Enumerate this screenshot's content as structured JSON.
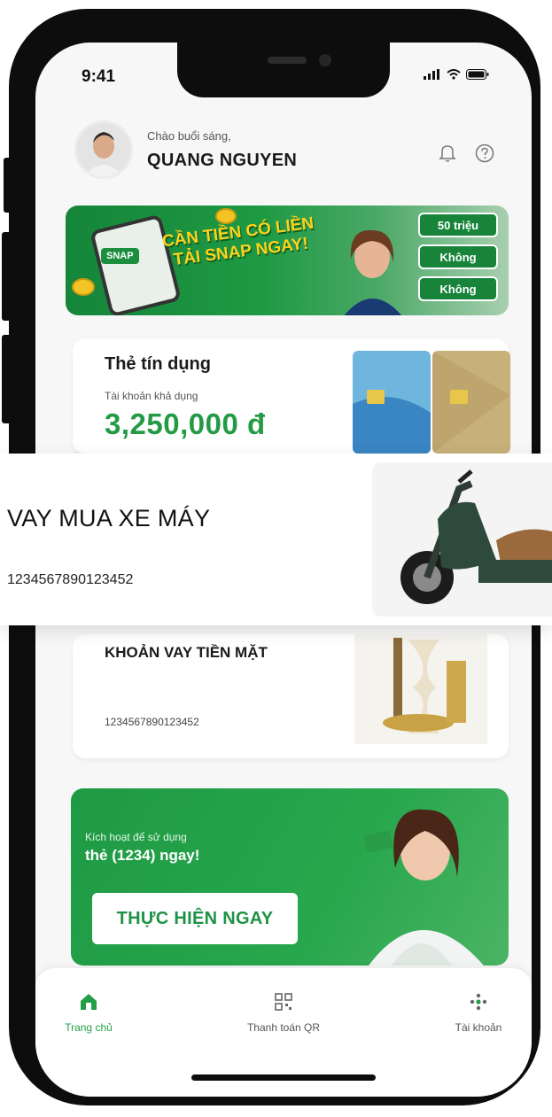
{
  "status_bar": {
    "time": "9:41"
  },
  "header": {
    "greeting": "Chào buổi sáng,",
    "user_name": "QUANG NGUYEN"
  },
  "banner": {
    "headline_line1": "CẦN TIỀN CÓ LIỀN",
    "headline_line2": "TẢI SNAP NGAY!",
    "app_tag": "SNAP",
    "pills": [
      "50 triệu",
      "Không",
      "Không"
    ]
  },
  "credit_card": {
    "title": "Thẻ tín dụng",
    "subtitle": "Tài khoản khả dụng",
    "amount": "3,250,000 đ"
  },
  "motorbike_loan": {
    "title": "VAY MUA XE MÁY",
    "contract_number": "1234567890123452"
  },
  "cash_loan": {
    "title": "KHOẢN VAY TIỀN MẶT",
    "contract_number": "1234567890123452"
  },
  "promo": {
    "subtitle": "Kích hoạt để sử dụng",
    "title": "thẻ (1234) ngay!",
    "button_label": "THỰC HIỆN NGAY"
  },
  "bottom_nav": {
    "items": [
      {
        "label": "Trang chủ",
        "icon": "home-icon",
        "active": true
      },
      {
        "label": "Thanh toán QR",
        "icon": "qr-icon",
        "active": false
      },
      {
        "label": "Tài khoản",
        "icon": "account-icon",
        "active": false
      }
    ]
  },
  "colors": {
    "brand_green": "#23a047",
    "amount_green": "#239b45",
    "banner_yellow": "#ffd21a"
  }
}
